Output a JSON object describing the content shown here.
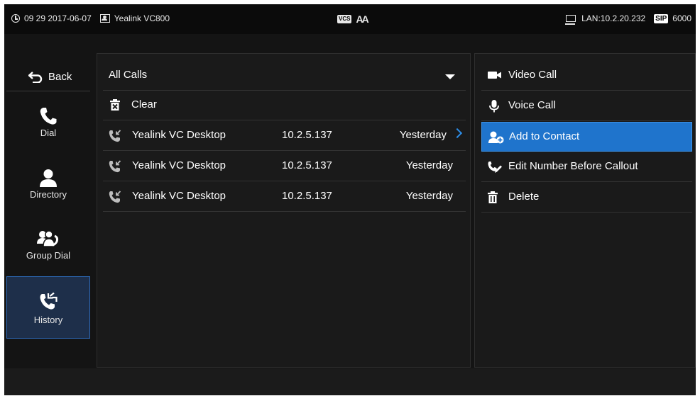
{
  "status": {
    "datetime": "09 29 2017-06-07",
    "device": "Yealink VC800",
    "vcs_badge": "VCS",
    "font_badge": "AA",
    "lan": "LAN:10.2.20.232",
    "sip_badge": "SIP",
    "sip_account": "6000"
  },
  "nav": {
    "back": "Back",
    "items": [
      {
        "label": "Dial",
        "icon": "phone-icon"
      },
      {
        "label": "Directory",
        "icon": "person-icon"
      },
      {
        "label": "Group Dial",
        "icon": "group-icon"
      },
      {
        "label": "History",
        "icon": "history-icon",
        "selected": true
      }
    ]
  },
  "calls": {
    "filter": "All Calls",
    "clear": "Clear",
    "rows": [
      {
        "name": "Yealink VC Desktop",
        "number": "10.2.5.137",
        "time": "Yesterday",
        "selected": true
      },
      {
        "name": "Yealink VC Desktop",
        "number": "10.2.5.137",
        "time": "Yesterday"
      },
      {
        "name": "Yealink VC Desktop",
        "number": "10.2.5.137",
        "time": "Yesterday"
      }
    ]
  },
  "actions": [
    {
      "label": "Video Call",
      "icon": "video-camera-icon"
    },
    {
      "label": "Voice Call",
      "icon": "microphone-icon"
    },
    {
      "label": "Add to Contact",
      "icon": "add-contact-icon",
      "selected": true
    },
    {
      "label": "Edit Number Before Callout",
      "icon": "edit-number-icon"
    },
    {
      "label": "Delete",
      "icon": "trash-icon"
    }
  ],
  "colors": {
    "accent": "#1f74cc",
    "chevron": "#2d8ee8",
    "background": "#141414"
  }
}
